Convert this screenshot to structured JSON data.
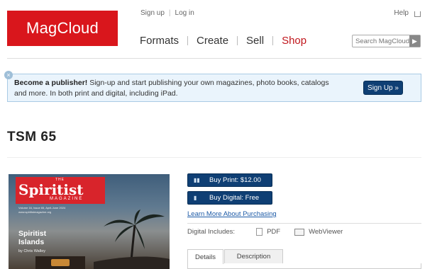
{
  "brand": {
    "logo_text": "MagCloud",
    "color": "#d9161c"
  },
  "top_links": {
    "signup": "Sign up",
    "login": "Log in",
    "help": "Help"
  },
  "nav": {
    "formats": "Formats",
    "create": "Create",
    "sell": "Sell",
    "shop": "Shop",
    "active_color": "#c0151b"
  },
  "search": {
    "placeholder": "Search MagCloud"
  },
  "banner": {
    "bold": "Become a publisher!",
    "text": " Sign-up and start publishing your own magazines, photo books, catalogs and more. In both print and digital, including iPad.",
    "button": "Sign Up »"
  },
  "page": {
    "title": "TSM 65"
  },
  "cover": {
    "the": "THE",
    "masthead": "Spiritist",
    "magazine": "MAGAZINE",
    "issue_line": "Volume 16, Issue 65, April-June 2024",
    "site": "www.spiritistmagazine.org",
    "story_title_1": "Spiritist",
    "story_title_2": "Islands",
    "byline": "by Chris Walley"
  },
  "purchase": {
    "print_label": "Buy Print: $12.00",
    "digital_label": "Buy Digital: Free",
    "learn_more": "Learn More About Purchasing",
    "digital_includes": "Digital Includes:",
    "pdf": "PDF",
    "webviewer": "WebViewer"
  },
  "tabs": {
    "details": "Details",
    "description": "Description"
  },
  "colors": {
    "button_blue": "#0f3f74",
    "banner_bg": "#eaf4fc",
    "link_blue": "#1c5aa6"
  }
}
